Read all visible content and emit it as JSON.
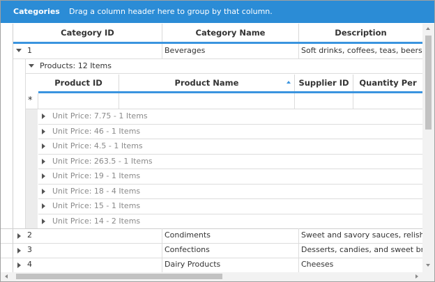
{
  "header": {
    "title": "Categories",
    "hint": "Drag a column header here to group by that column."
  },
  "columns": [
    "Category ID",
    "Category Name",
    "Description"
  ],
  "expanded_row": {
    "id": "1",
    "name": "Beverages",
    "description": "Soft drinks, coffees, teas, beers, an"
  },
  "child_group_label": "Products: 12 Items",
  "child_columns": [
    "Product ID",
    "Product Name",
    "Supplier ID",
    "Quantity Per"
  ],
  "new_row_marker": "*",
  "price_groups": [
    "Unit Price: 7.75 - 1 Items",
    "Unit Price: 46 - 1 Items",
    "Unit Price: 4.5 - 1 Items",
    "Unit Price: 263.5 - 1 Items",
    "Unit Price: 19 - 1 Items",
    "Unit Price: 18 - 4 Items",
    "Unit Price: 15 - 1 Items",
    "Unit Price: 14 - 2 Items"
  ],
  "rows": [
    {
      "id": "2",
      "name": "Condiments",
      "description": "Sweet and savory sauces, relishes"
    },
    {
      "id": "3",
      "name": "Confections",
      "description": "Desserts, candies, and sweet brea"
    },
    {
      "id": "4",
      "name": "Dairy Products",
      "description": "Cheeses"
    }
  ],
  "colors": {
    "accent": "#2b8cd6",
    "grid_line": "#dcdcdc",
    "group_text": "#8a8a8a"
  }
}
